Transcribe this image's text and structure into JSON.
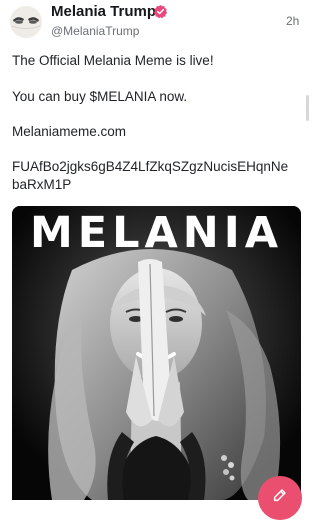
{
  "author": {
    "name": "Melania Trump",
    "handle": "@MelaniaTrump",
    "verified_icon": "verified-badge-icon",
    "verified_color": "#e8497a"
  },
  "post": {
    "timestamp": "2h",
    "lines": [
      "The Official Melania Meme is live!",
      "You can buy $MELANIA now.",
      "Melaniameme.com",
      "FUAfBo2jgks6gB4Z4LfZkqSZgzNucisEHqnNe",
      "baRxM1P"
    ],
    "media_title": "MELANIA"
  },
  "actions": {
    "compose_icon": "compose-pencil-icon",
    "compose_color": "#ea4f70"
  }
}
